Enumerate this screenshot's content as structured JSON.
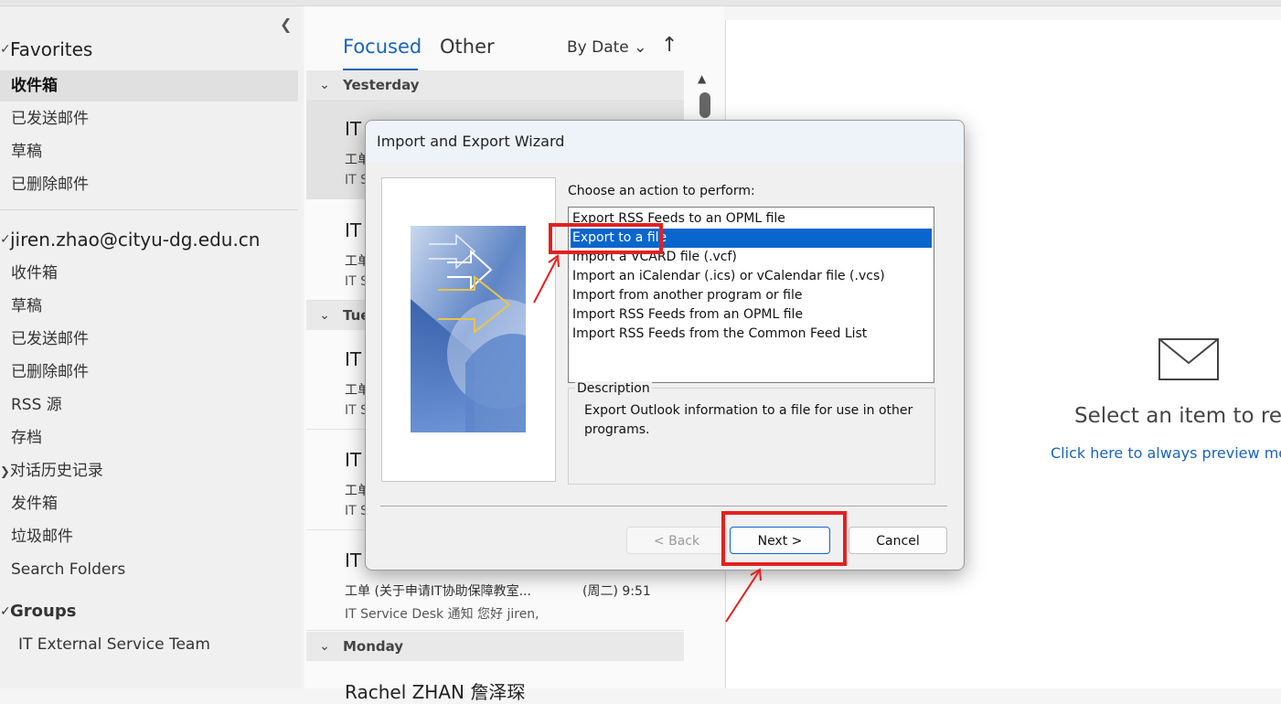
{
  "folder_pane": {
    "collapse_icon": "chevron-left",
    "favorites": {
      "label": "Favorites",
      "items": [
        "收件箱",
        "已发送邮件",
        "草稿",
        "已删除邮件"
      ]
    },
    "account": {
      "label": "jiren.zhao@cityu-dg.edu.cn",
      "items": [
        "收件箱",
        "草稿",
        "已发送邮件",
        "已删除邮件",
        "RSS 源",
        "存档",
        "对话历史记录",
        "发件箱",
        "垃圾邮件",
        "Search Folders"
      ]
    },
    "groups": {
      "label": "Groups",
      "items": [
        "IT External Service Team"
      ]
    }
  },
  "mail_list": {
    "tabs": [
      "Focused",
      "Other"
    ],
    "sort_label": "By Date",
    "groups": [
      "Yesterday",
      "Tue",
      "Monday"
    ],
    "messages": [
      {
        "sender": "IT",
        "subject": "工单",
        "preview": "IT S",
        "time": ""
      },
      {
        "sender": "IT",
        "subject": "工单",
        "preview": "IT S",
        "time": ""
      },
      {
        "sender": "IT",
        "subject": "工单",
        "preview": "IT S",
        "time": ""
      },
      {
        "sender": "IT",
        "subject": "工单",
        "preview": "IT S",
        "time": ""
      },
      {
        "sender": "IT",
        "subject": "工单 (关于申请IT协助保障教室...",
        "preview": "IT Service Desk 通知  您好 jiren,",
        "time": "(周二) 9:51"
      },
      {
        "sender": "Rachel ZHAN 詹泽琛",
        "subject": "",
        "preview": "",
        "time": ""
      }
    ]
  },
  "reading_pane": {
    "select_text": "Select an item to rea",
    "preview_link": "Click here to always preview mes"
  },
  "dialog": {
    "title": "Import and Export Wizard",
    "choose_label": "Choose an action to perform:",
    "actions": [
      "Export RSS Feeds to an OPML file",
      "Export to a file",
      "Import a VCARD file (.vcf)",
      "Import an iCalendar (.ics) or vCalendar file (.vcs)",
      "Import from another program or file",
      "Import RSS Feeds from an OPML file",
      "Import RSS Feeds from the Common Feed List"
    ],
    "selected_action_index": 1,
    "description_label": "Description",
    "description_text": "Export Outlook information to a file for use in other programs.",
    "buttons": {
      "back": "< Back",
      "next": "Next >",
      "cancel": "Cancel"
    }
  },
  "colors": {
    "accent": "#1a63b8",
    "selection": "#0a66cc",
    "annotation": "#e12121"
  }
}
